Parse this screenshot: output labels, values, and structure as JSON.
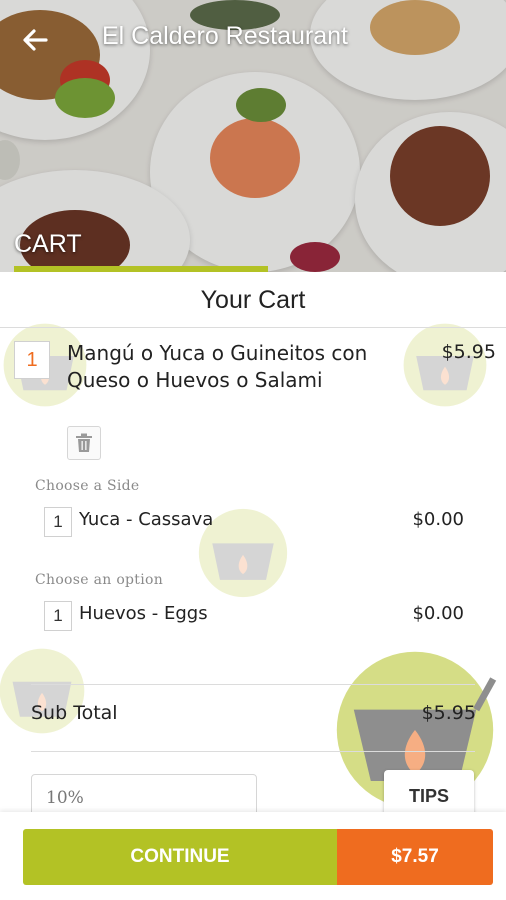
{
  "header": {
    "title": "El Caldero Restaurant",
    "back_icon": "arrow-left-icon",
    "section_label": "CART"
  },
  "cart": {
    "heading": "Your Cart",
    "item": {
      "quantity": "1",
      "name": "Mangú o Yuca o Guineitos con Queso o Huevos o Salami",
      "price": "$5.95",
      "delete_icon": "trash-icon"
    },
    "options": [
      {
        "label": "Choose a Side",
        "quantity": "1",
        "name": "Yuca - Cassava",
        "price": "$0.00"
      },
      {
        "label": "Choose an option",
        "quantity": "1",
        "name": "Huevos - Eggs",
        "price": "$0.00"
      }
    ],
    "subtotal_label": "Sub Total",
    "subtotal_value": "$5.95",
    "tips_value": "10%",
    "tips_button": "TIPS"
  },
  "footer": {
    "continue_label": "CONTINUE",
    "total_label": "$7.57"
  },
  "colors": {
    "accent_green": "#b3c225",
    "accent_orange": "#ef6c1f"
  }
}
